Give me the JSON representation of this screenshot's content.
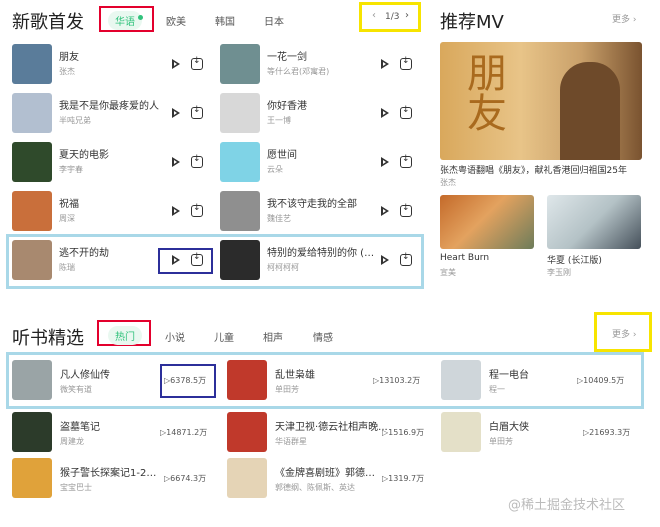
{
  "new_songs": {
    "title": "新歌首发",
    "tabs": [
      "华语",
      "欧美",
      "韩国",
      "日本"
    ],
    "page": "1/3",
    "left": [
      {
        "name": "朋友",
        "artist": "张杰",
        "color": "#5a7c9a"
      },
      {
        "name": "我是不是你最疼爱的人",
        "artist": "半吨兄弟",
        "color": "#b2bfd0"
      },
      {
        "name": "夏天的电影",
        "artist": "李宇春",
        "color": "#2f4a2b"
      },
      {
        "name": "祝福",
        "artist": "周深",
        "color": "#c96f3b"
      },
      {
        "name": "逃不开的劫",
        "artist": "陈瑞",
        "color": "#a8896f"
      }
    ],
    "right": [
      {
        "name": "一花一剑",
        "artist": "等什么君(邓寓君)",
        "color": "#6f8f91"
      },
      {
        "name": "你好香港",
        "artist": "王一博",
        "color": "#d8d8d8"
      },
      {
        "name": "愿世间",
        "artist": "云朵",
        "color": "#7fd3e6"
      },
      {
        "name": "我不该守走我的全部",
        "artist": "魏佳艺",
        "color": "#8f8f8f"
      },
      {
        "name": "特别的爱给特别的你 (柯...",
        "artist": "柯柯柯柯",
        "color": "#2b2b2b"
      }
    ]
  },
  "mv": {
    "title": "推荐MV",
    "more": "更多",
    "main": {
      "title": "张杰粤语翻唱《朋友》，献礼香港回归祖国25年",
      "artist": "张杰",
      "poster_text": "朋友"
    },
    "items": [
      {
        "title": "Heart Burn",
        "artist": "宣美"
      },
      {
        "title": "华夏 (长江版)",
        "artist": "李玉刚"
      }
    ]
  },
  "audiobooks": {
    "title": "听书精选",
    "tabs": [
      "热门",
      "小说",
      "儿童",
      "相声",
      "情感"
    ],
    "more": "更多",
    "rows": [
      [
        {
          "name": "凡人修仙传",
          "artist": "微笑有道",
          "plays": "6378.5万",
          "color": "#9aa4a6"
        },
        {
          "name": "乱世枭雄",
          "artist": "单田芳",
          "plays": "13103.2万",
          "color": "#c0392b"
        },
        {
          "name": "程一电台",
          "artist": "程一",
          "plays": "10409.5万",
          "color": "#cfd6da"
        }
      ],
      [
        {
          "name": "盗墓笔记",
          "artist": "周建龙",
          "plays": "14871.2万",
          "color": "#2c3b2a"
        },
        {
          "name": "天津卫视·德云社相声晚...",
          "artist": "华语群星",
          "plays": "1516.9万",
          "color": "#c0392b"
        },
        {
          "name": "白眉大侠",
          "artist": "单田芳",
          "plays": "21693.3万",
          "color": "#e4e0c8"
        }
      ],
      [
        {
          "name": "猴子警长探案记1-2季|...",
          "artist": "宝宝巴士",
          "plays": "6674.3万",
          "color": "#e0a23a"
        },
        {
          "name": "《金牌喜剧班》郭德纲...",
          "artist": "郭德纲、陈佩斯、英达",
          "plays": "1319.7万",
          "color": "#e5d4b6"
        }
      ]
    ]
  },
  "footer": {
    "watermark": "@稀土掘金技术社区"
  }
}
